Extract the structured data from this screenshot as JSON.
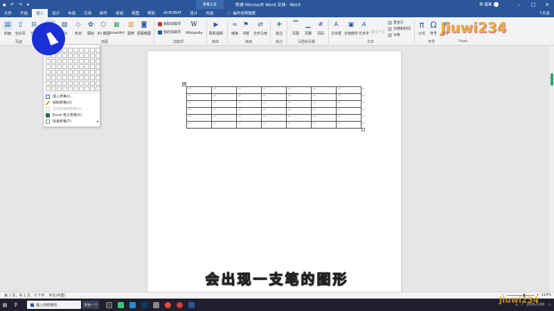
{
  "titlebar": {
    "context_tab": "表格工具",
    "title": "新建 Microsoft Word 文档 - Word",
    "user": "谢 福禹",
    "save_icon": "save-icon",
    "undo_icon": "undo-icon",
    "redo_icon": "redo-icon"
  },
  "tabs": {
    "items": [
      "文件",
      "开始",
      "插入",
      "设计",
      "布局",
      "引用",
      "邮件",
      "审阅",
      "视图",
      "帮助",
      "ACROBAT",
      "设计",
      "布局"
    ],
    "active": "插入",
    "tell_me": "操作说明搜索",
    "share": "共享"
  },
  "ribbon": {
    "cover": "封面",
    "blank_page": "空白页",
    "page_break": "分页",
    "table": "表格",
    "pictures": "图片",
    "shapes": "形状",
    "icons": "图标",
    "model_3d": "3D 模型",
    "smartart": "SmartArt",
    "chart": "图表",
    "screenshot": "屏幕截图",
    "get_addins": "获取加载项",
    "my_addins": "我的加载项",
    "wikipedia": "Wikipedia",
    "online_video": "联机视频",
    "link": "链接",
    "bookmark": "书签",
    "cross_ref": "交叉引用",
    "comment": "批注",
    "header": "页眉",
    "footer": "页脚",
    "page_number": "页码",
    "textbox": "文本框",
    "quick_parts": "文档部件",
    "wordart": "艺术字",
    "drop_cap": "首字下沉",
    "signature": "签名行",
    "date_time": "日期和时间",
    "object": "对象",
    "equation": "公式",
    "symbol": "符号",
    "number": "编号",
    "groups": {
      "pages": "页面",
      "illustrations": "插图",
      "addins": "加载项",
      "media": "媒体",
      "links": "链接",
      "comments": "批注",
      "header_footer": "页眉和页脚",
      "text": "文本",
      "symbols": "符号",
      "flash": "Flash"
    }
  },
  "logo_text": "Jiuwi234",
  "table_menu": {
    "items": [
      {
        "label": "插入表格(I)...",
        "disabled": false,
        "icon": "table-icon"
      },
      {
        "label": "绘制表格(D)",
        "disabled": false,
        "icon": "pencil-icon"
      },
      {
        "label": "文本转换成表格(V)...",
        "disabled": true,
        "icon": "convert-icon"
      },
      {
        "label": "Excel 电子表格(X)",
        "disabled": false,
        "icon": "excel-icon"
      },
      {
        "label": "快速表格(T)",
        "disabled": false,
        "icon": "quick-table-icon"
      }
    ]
  },
  "document": {
    "cell_mark": "↵",
    "rows": 6,
    "cols": 7
  },
  "subtitle": "会出现一支笔的图形",
  "statusbar": {
    "page": "第 1 页，共 1 页",
    "words": "0 个字",
    "language": "中文(中国)",
    "zoom": "110%"
  },
  "taskbar": {
    "search_placeholder": "输入你想搜的",
    "search_button": "搜索一下",
    "time": "",
    "date": "2021/1/16"
  },
  "colors": {
    "word_blue": "#2b579a",
    "cursor_circle": "#1a2fd6"
  }
}
